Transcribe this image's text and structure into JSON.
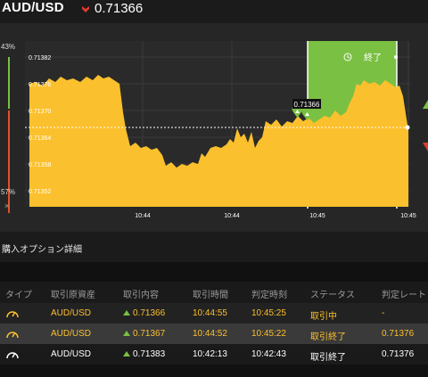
{
  "header": {
    "pair": "AUD/USD",
    "price": "0.71366",
    "direction": "down",
    "direction_color": "#e03a2f"
  },
  "sentiment": {
    "up_pct": "43%",
    "down_pct": "57%",
    "up_color": "#7ac043",
    "down_color": "#e0532a",
    "close": "×"
  },
  "chart": {
    "y_ticks": [
      "0.71382",
      "0.71376",
      "0.71370",
      "0.71364",
      "0.71358",
      "0.71352"
    ],
    "x_ticks": [
      "10:44",
      "10:44",
      "10:45",
      "10:45"
    ],
    "end_label": "終了",
    "marker_price": "0.71366",
    "area_color": "#fbc02d",
    "expiry_zone_color": "#7ac043"
  },
  "section": {
    "title": "購入オプション詳細"
  },
  "table": {
    "columns": [
      "タイプ",
      "取引原資産",
      "取引内容",
      "取引時間",
      "判定時刻",
      "ステータス",
      "判定レート"
    ],
    "rows": [
      {
        "asset": "AUD/USD",
        "content": "0.71366",
        "time": "10:44:55",
        "judge_time": "10:45:25",
        "status": "取引中",
        "rate": "-",
        "color": "#fbc02d"
      },
      {
        "asset": "AUD/USD",
        "content": "0.71367",
        "time": "10:44:52",
        "judge_time": "10:45:22",
        "status": "取引終了",
        "rate": "0.71376",
        "color": "#fbc02d"
      },
      {
        "asset": "AUD/USD",
        "content": "0.71383",
        "time": "10:42:13",
        "judge_time": "10:42:43",
        "status": "取引終了",
        "rate": "0.71376",
        "color": "#ffffff"
      }
    ]
  }
}
